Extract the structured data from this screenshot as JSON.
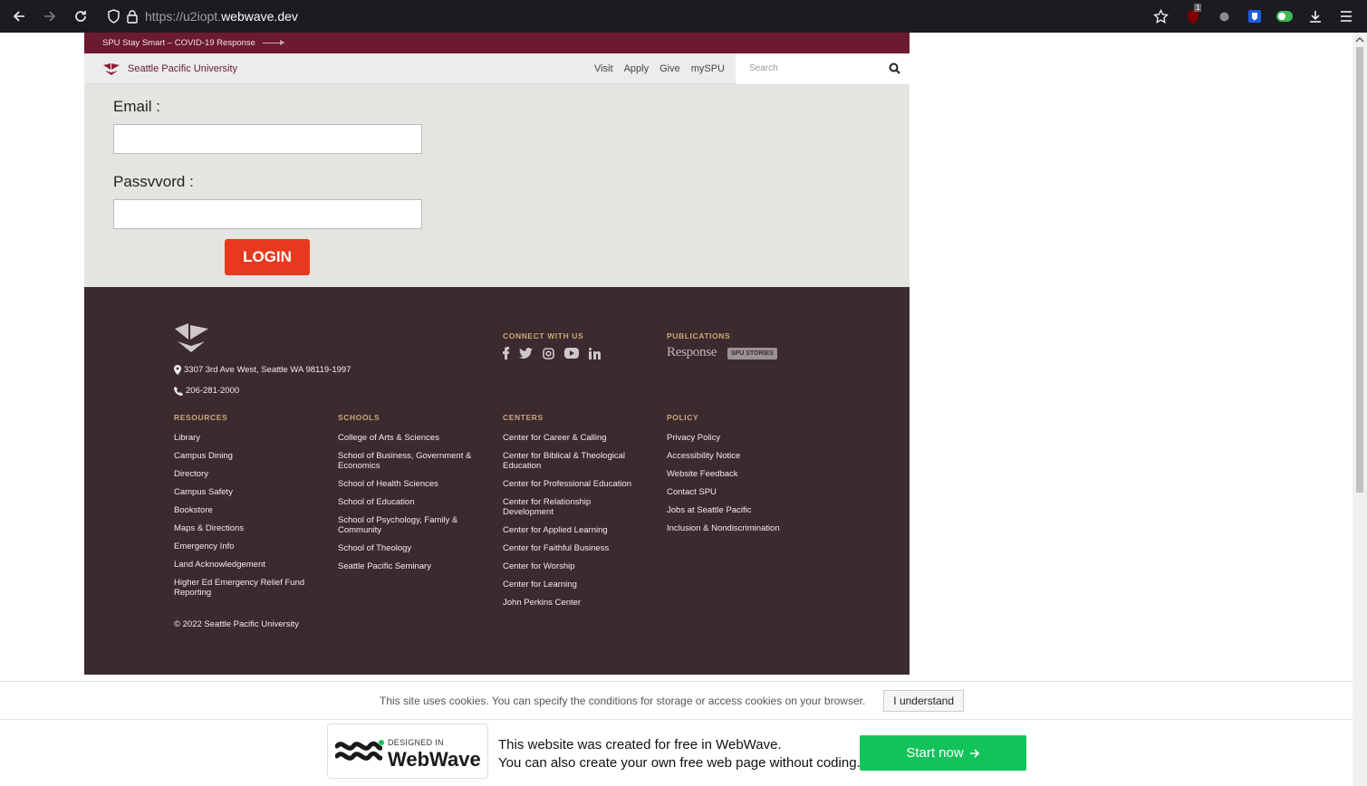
{
  "browser": {
    "url_prefix": "https://u2iopt.",
    "url_domain": "webwave.dev",
    "ublock_badge": "1"
  },
  "site": {
    "covid_link": "SPU Stay Smart – COVID-19 Response",
    "brand_name": "Seattle Pacific University",
    "nav": [
      "Visit",
      "Apply",
      "Give",
      "mySPU"
    ],
    "search_placeholder": "Search",
    "login": {
      "email_label": "Email :",
      "password_label": "Passvvord :",
      "button": "LOGIN"
    },
    "footer": {
      "address": "3307 3rd Ave West, Seattle WA 98119-1997",
      "phone": "206-281-2000",
      "connect_heading": "CONNECT WITH US",
      "publications_heading": "PUBLICATIONS",
      "publications": [
        "Response",
        "SPU STORIES"
      ],
      "columns": [
        {
          "heading": "RESOURCES",
          "items": [
            "Library",
            "Campus Dining",
            "Directory",
            "Campus Safety",
            "Bookstore",
            "Maps & Directions",
            "Emergency Info",
            "Land Acknowledgement",
            "Higher Ed Emergency Relief Fund Reporting"
          ]
        },
        {
          "heading": "SCHOOLS",
          "items": [
            "College of Arts & Sciences",
            "School of Business, Government & Economics",
            "School of Health Sciences",
            "School of Education",
            "School of Psychology, Family & Community",
            "School of Theology",
            "Seattle Pacific Seminary"
          ]
        },
        {
          "heading": "CENTERS",
          "items": [
            "Center for Career & Calling",
            "Center for Biblical & Theological Education",
            "Center for Professional Education",
            "Center for Relationship Development",
            "Center for Applied Learning",
            "Center for Faithful Business",
            "Center for Worship",
            "Center for Learning",
            "John Perkins Center"
          ]
        },
        {
          "heading": "POLICY",
          "items": [
            "Privacy Policy",
            "Accessibility Notice",
            "Website Feedback",
            "Contact SPU",
            "Jobs at Seattle Pacific",
            "Inclusion & Nondiscrimination"
          ]
        }
      ],
      "copyright": "© 2022 Seattle Pacific University"
    }
  },
  "cookie": {
    "text": "This site uses cookies. You can specify the conditions for storage or access cookies on your browser.",
    "button": "I understand"
  },
  "banner": {
    "designed_in": "DESIGNED IN",
    "brand": "WebWave",
    "line1": "This website was created for free in WebWave.",
    "line2": "You can also create your own free web page without coding.",
    "cta": "Start now"
  },
  "colors": {
    "maroon": "#6b1a30",
    "footer_bg": "#3b2a2e",
    "login_btn": "#e8391f",
    "cta_green": "#12c35a"
  }
}
